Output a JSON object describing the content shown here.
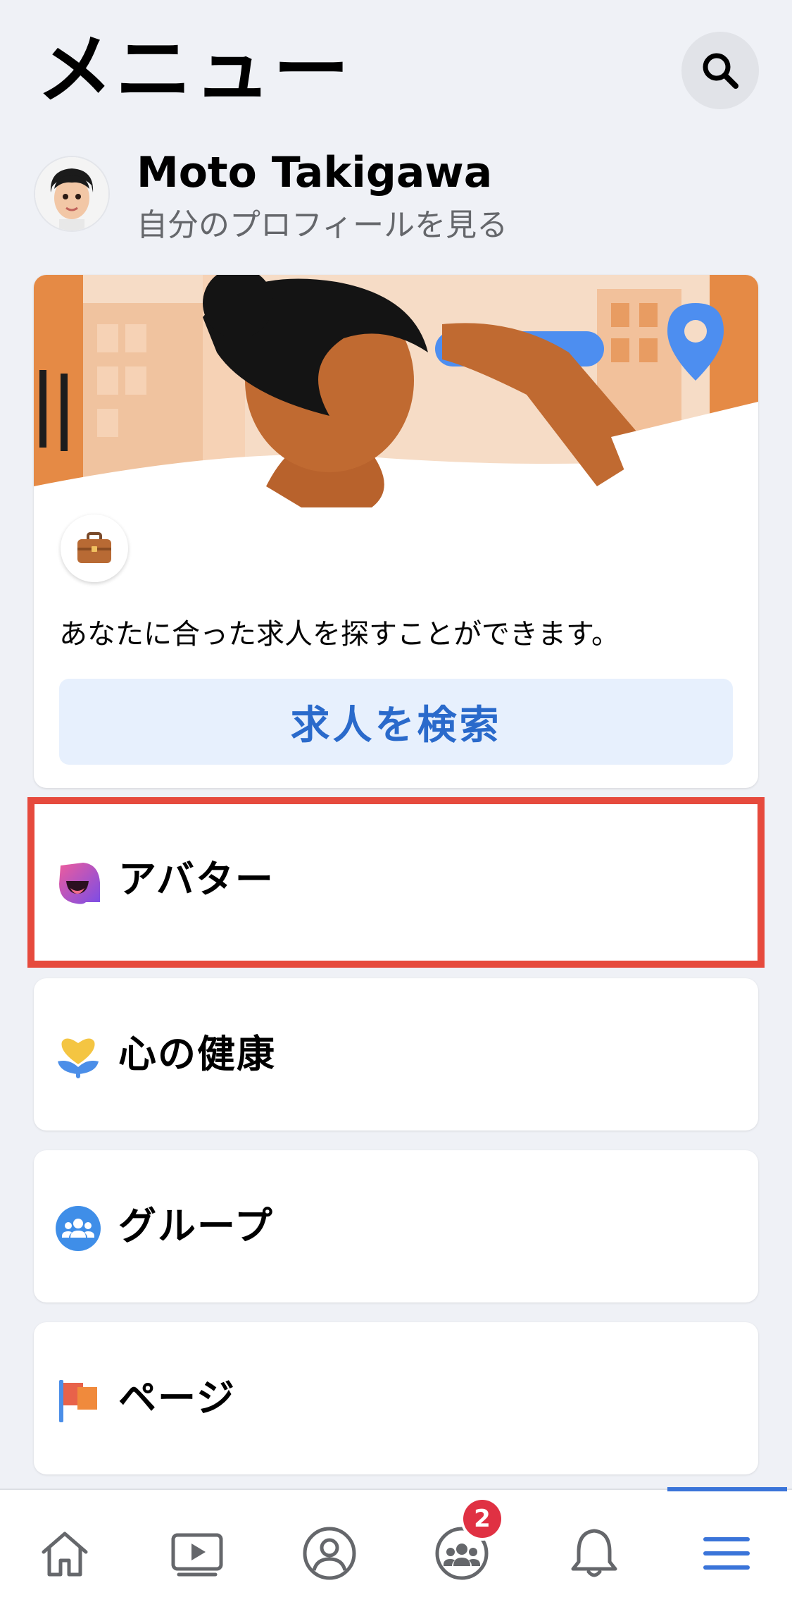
{
  "header": {
    "title": "メニュー"
  },
  "profile": {
    "name": "Moto Takigawa",
    "subtitle": "自分のプロフィールを見る"
  },
  "job_card": {
    "description": "あなたに合った求人を探すことができます。",
    "button_label": "求人を検索"
  },
  "menu": {
    "items": [
      {
        "label": "アバター",
        "icon": "avatar-icon"
      },
      {
        "label": "心の健康",
        "icon": "heart-hands-icon"
      },
      {
        "label": "グループ",
        "icon": "groups-icon"
      },
      {
        "label": "ページ",
        "icon": "flag-icon"
      }
    ]
  },
  "bottom_nav": {
    "items": [
      {
        "icon": "home-icon"
      },
      {
        "icon": "video-icon"
      },
      {
        "icon": "profile-icon"
      },
      {
        "icon": "groups-icon",
        "badge": "2"
      },
      {
        "icon": "bell-icon"
      },
      {
        "icon": "hamburger-menu-icon",
        "active": true
      }
    ]
  },
  "colors": {
    "accent": "#3a74d9",
    "highlight": "#e64a3d",
    "badge": "#e03143",
    "background": "#eff1f6"
  }
}
